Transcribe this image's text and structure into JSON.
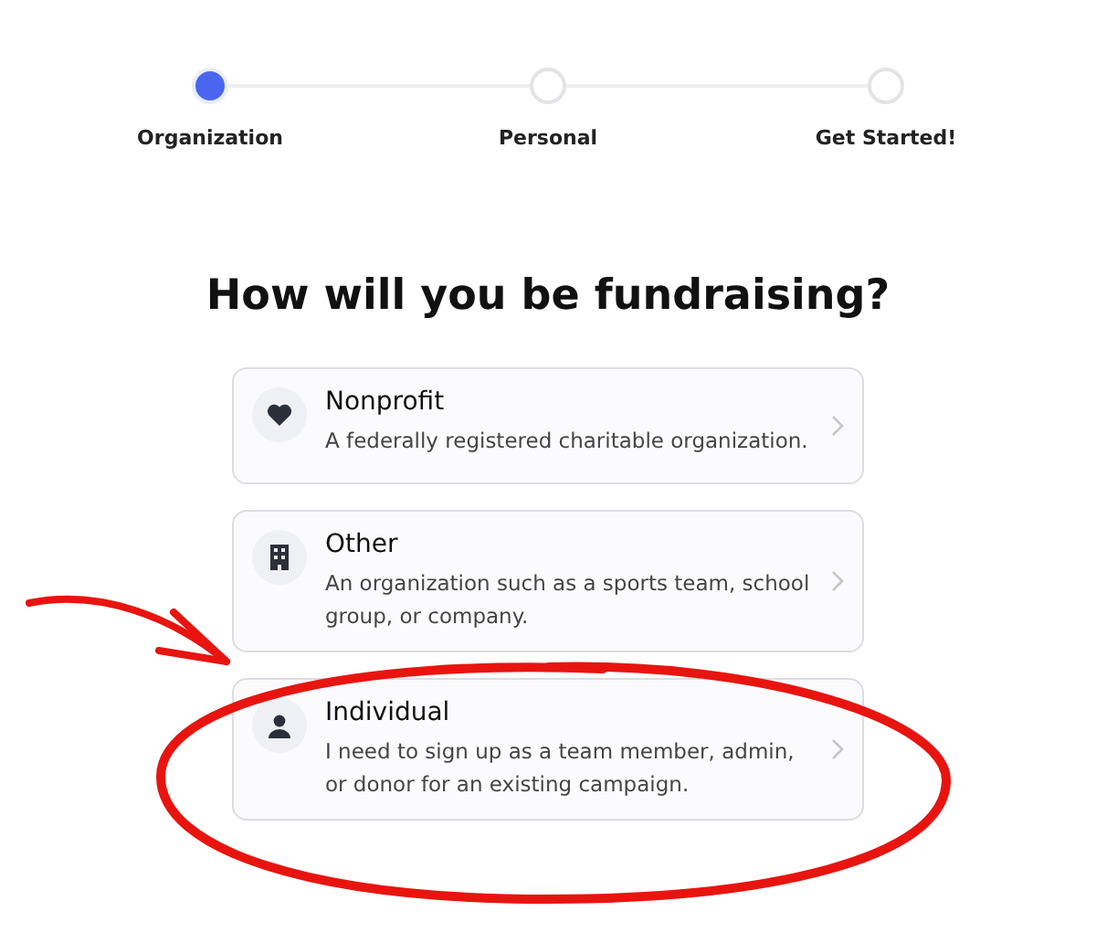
{
  "steps": [
    {
      "label": "Organization",
      "selected": true
    },
    {
      "label": "Personal",
      "selected": false
    },
    {
      "label": "Get Started!",
      "selected": false
    }
  ],
  "heading": "How will you be fundraising?",
  "options": [
    {
      "kind": "heart",
      "title": "Nonprofit",
      "description": "A federally registered charitable organization."
    },
    {
      "kind": "building",
      "title": "Other",
      "description": "An organization such as a sports team, school group, or company."
    },
    {
      "kind": "person",
      "title": "Individual",
      "description": "I need to sign up as a team member, admin, or donor for an existing campaign."
    }
  ]
}
